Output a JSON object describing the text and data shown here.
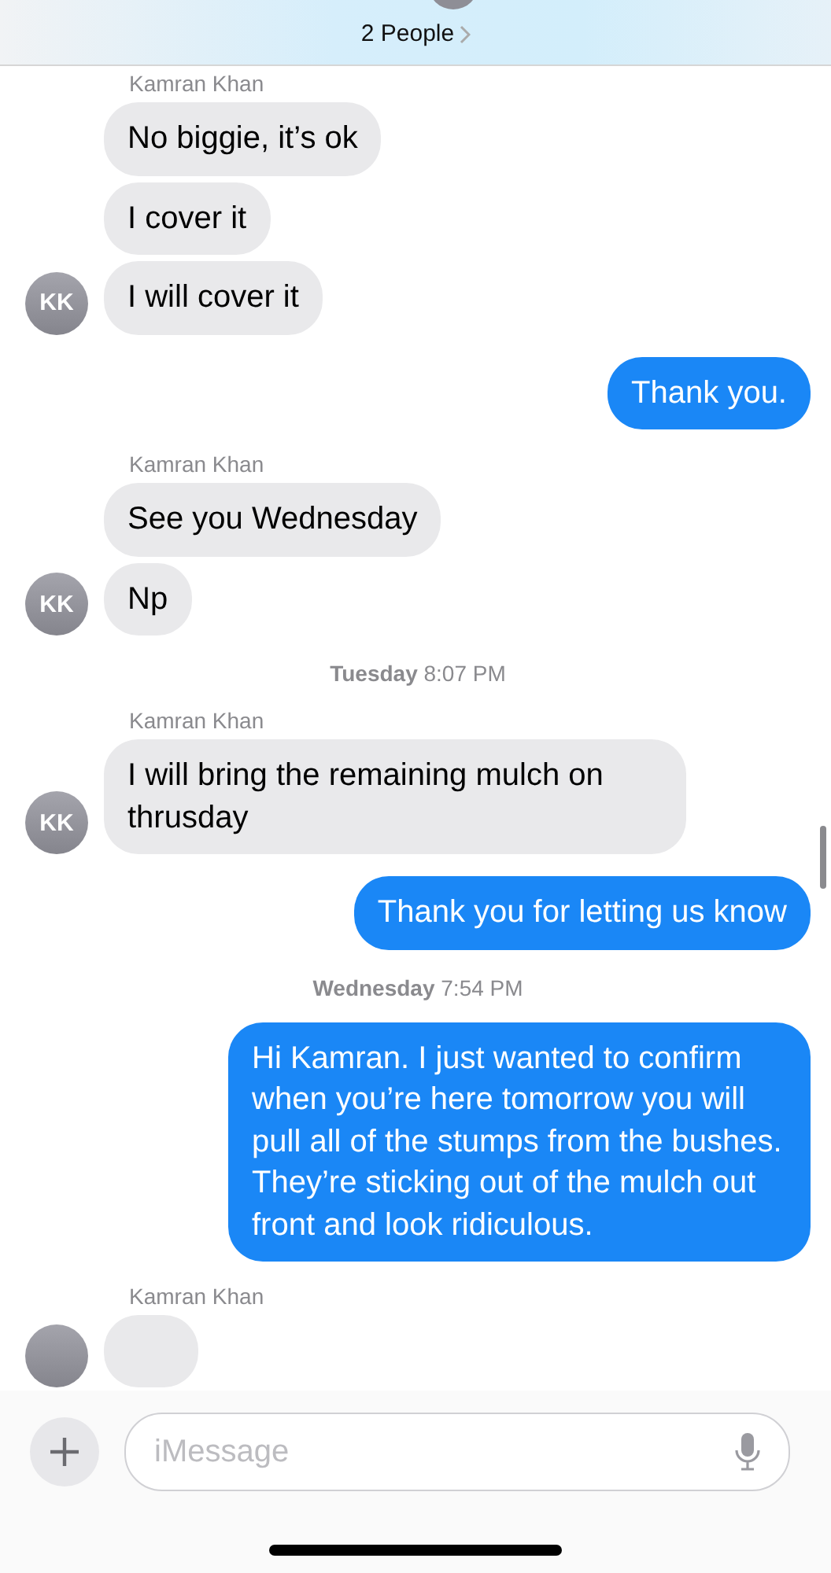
{
  "header": {
    "title": "2 People"
  },
  "timeline": [
    {
      "kind": "incoming",
      "sender": "Kamran Khan",
      "initials": "KK",
      "messages": [
        "No biggie, it’s ok",
        "I cover it",
        "I will cover it"
      ]
    },
    {
      "kind": "outgoing",
      "messages": [
        "Thank you."
      ]
    },
    {
      "kind": "incoming",
      "sender": "Kamran Khan",
      "initials": "KK",
      "messages": [
        "See you Wednesday",
        "Np"
      ]
    },
    {
      "kind": "timestamp",
      "text": "**Tuesday** 8:07 PM"
    },
    {
      "kind": "incoming",
      "sender": "Kamran Khan",
      "initials": "KK",
      "messages": [
        "I will bring the remaining mulch on thrusday"
      ]
    },
    {
      "kind": "outgoing",
      "messages": [
        "Thank you for letting us know"
      ]
    },
    {
      "kind": "timestamp",
      "text": "**Wednesday** 7:54 PM"
    },
    {
      "kind": "outgoing",
      "messages": [
        "Hi Kamran. I just wanted to confirm when you’re here tomorrow you will pull all of the stumps from the bushes. They’re sticking out of the mulch out front and look ridiculous."
      ]
    },
    {
      "kind": "covered",
      "sender": "Kamran Khan"
    }
  ],
  "composer": {
    "placeholder": "iMessage"
  }
}
